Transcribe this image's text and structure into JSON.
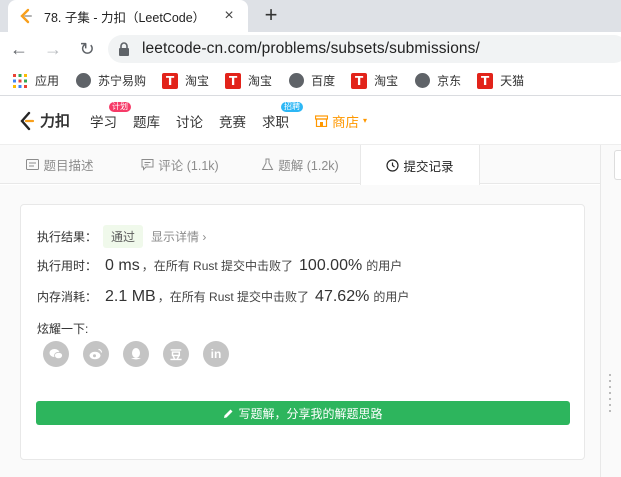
{
  "browser": {
    "tab_title": "78. 子集 - 力扣（LeetCode）",
    "tab_close": "×",
    "new_tab": "+",
    "url": "leetcode-cn.com/problems/subsets/submissions/",
    "nav": {
      "back": "←",
      "forward": "→",
      "reload": "↻"
    }
  },
  "bookmarks": [
    {
      "label": "应用",
      "icon": "apps-grid-icon"
    },
    {
      "label": "苏宁易购",
      "icon": "globe-icon"
    },
    {
      "label": "淘宝",
      "icon": "taobao-t-icon"
    },
    {
      "label": "淘宝",
      "icon": "taobao-t-icon"
    },
    {
      "label": "百度",
      "icon": "globe-icon"
    },
    {
      "label": "淘宝",
      "icon": "taobao-t-icon"
    },
    {
      "label": "京东",
      "icon": "globe-icon"
    },
    {
      "label": "天猫",
      "icon": "taobao-t-icon"
    }
  ],
  "bookmark_t_glyph": "T",
  "lc_nav": {
    "logo_text": "力扣",
    "items": [
      {
        "label": "学习",
        "badge": "计划"
      },
      {
        "label": "题库"
      },
      {
        "label": "讨论"
      },
      {
        "label": "竞赛"
      },
      {
        "label": "求职",
        "badge": "招聘"
      }
    ],
    "shop_label": "商店",
    "shop_caret": "▾"
  },
  "content_tabs": [
    {
      "label": "题目描述",
      "icon": "description-icon"
    },
    {
      "label": "评论 (1.1k)",
      "icon": "comment-icon"
    },
    {
      "label": "题解 (1.2k)",
      "icon": "flask-icon"
    },
    {
      "label": "提交记录",
      "icon": "clock-icon",
      "active": true
    }
  ],
  "result": {
    "status_label": "执行结果：",
    "status_value": "通过",
    "detail_link": "显示详情 ›",
    "time_label": "执行用时：",
    "time_value": "0 ms",
    "time_mid": "，在所有 Rust 提交中击败了",
    "time_pct": "100.00%",
    "time_suffix": "的用户",
    "mem_label": "内存消耗：",
    "mem_value": "2.1 MB",
    "mem_mid": "，在所有 Rust 提交中击败了",
    "mem_pct": "47.62%",
    "mem_suffix": "的用户",
    "share_label": "炫耀一下:",
    "share_icons": [
      "wechat-icon",
      "weibo-icon",
      "qq-icon",
      "douban-icon",
      "linkedin-icon"
    ],
    "share_glyphs": [
      "",
      "",
      "",
      "豆",
      "in"
    ],
    "write_button": "写题解，分享我的解题思路"
  },
  "colors": {
    "accent_green": "#2db55d",
    "shop_orange": "#ff9800",
    "taobao_red": "#e2231a",
    "badge_red": "#f63b68",
    "badge_blue": "#2db7f5"
  }
}
